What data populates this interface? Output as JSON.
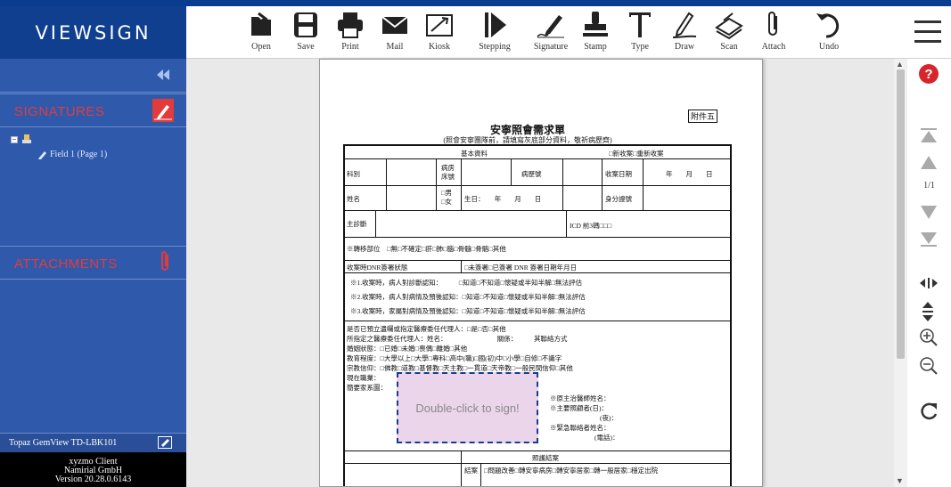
{
  "app": {
    "logo_text": "VIEWSIGN",
    "brand_color": "#0f3f8e"
  },
  "toolbar": {
    "tools": [
      {
        "label": "Open",
        "icon": "open-icon"
      },
      {
        "label": "Save",
        "icon": "save-icon"
      },
      {
        "label": "Print",
        "icon": "print-icon"
      },
      {
        "label": "Mail",
        "icon": "mail-icon"
      },
      {
        "label": "Kiosk",
        "icon": "kiosk-icon"
      },
      {
        "label": "Stepping",
        "icon": "stepping-icon"
      },
      {
        "label": "Signature",
        "icon": "signature-icon"
      },
      {
        "label": "Stamp",
        "icon": "stamp-icon"
      },
      {
        "label": "Type",
        "icon": "type-icon"
      },
      {
        "label": "Draw",
        "icon": "draw-icon"
      },
      {
        "label": "Scan",
        "icon": "scan-icon"
      },
      {
        "label": "Attach",
        "icon": "attach-icon"
      },
      {
        "label": "Undo",
        "icon": "undo-icon"
      }
    ]
  },
  "sidebar": {
    "signatures_title": "SIGNATURES",
    "attachments_title": "ATTACHMENTS",
    "field_item": "Field 1 (Page 1)",
    "pad_label": "Topaz GemView TD-LBK101",
    "version_lines": [
      "xyzmo Client",
      "Namirial GmbH",
      "Version 20.28.0.6143"
    ],
    "accent_color": "#e23b3b"
  },
  "document": {
    "fujian": "附件五",
    "title": "安寧照會需求單",
    "subtitle": "(照會安寧團隊前，請填寫灰底部分資料，敬祈病歷齊)",
    "section_basic": "基本資料",
    "new_case": "□新收案□重新收案",
    "row1": [
      "科別",
      "病房\n床號",
      "病歷號",
      "收案日期",
      "年　　月　　日"
    ],
    "row2": [
      "姓名",
      "□男\n□女",
      "生日：　　年　　月　　日",
      "身分證號"
    ],
    "row3": [
      "主診斷",
      "ICD 前3碼□□□"
    ],
    "row4": "※轉移部位　□無□不確定□肝□肺□腦□骨髓□骨骼□其他",
    "row5": [
      "收案時DNR簽署狀態",
      "□未簽署□已簽署 DNR 簽署日期年月日"
    ],
    "awareness": [
      "※1.收案時，病人對診斷認知：　　　□知道□不知道□懷疑或半知半解□無法評估",
      "※2.收案時，病人對病情及預後認知：□知道□不知道□懷疑或半知半解□無法評估",
      "※3.收案時，家屬對病情及預後認知：□知道□不知道□懷疑或半知半解□無法評估"
    ],
    "social": [
      "是否已預立遺囑或指定醫療委任代理人：□是□否□其他",
      "所指定之醫療委任代理人：姓名：　　　　　　　　關係：　　　其聯絡方式",
      "婚姻狀態：□已婚□未婚□喪偶□離婚□其他",
      "教育程度：□大學以上□大學□專科□高中(職)□國(初)中□小學□自修□不識字",
      "宗教信仰：□佛教□道教□基督教□天主教□一貫道□天帝教□一般民間信仰□其他",
      "現在職業：",
      "簡要家系圖："
    ],
    "signers": [
      "※原主治醫師姓名：",
      "※主要照顧者(日)：",
      "(夜)：",
      "※緊急聯絡者姓名：",
      "(電話)："
    ],
    "section_care": "照護結案",
    "care_opts_1": "□問題改善□轉安寧病房□轉安寧居家□轉一般居家□穩定出院",
    "care_label": "結案",
    "sig_prompt": "Double-click to sign!"
  },
  "navigation": {
    "page_count": "1/1"
  }
}
